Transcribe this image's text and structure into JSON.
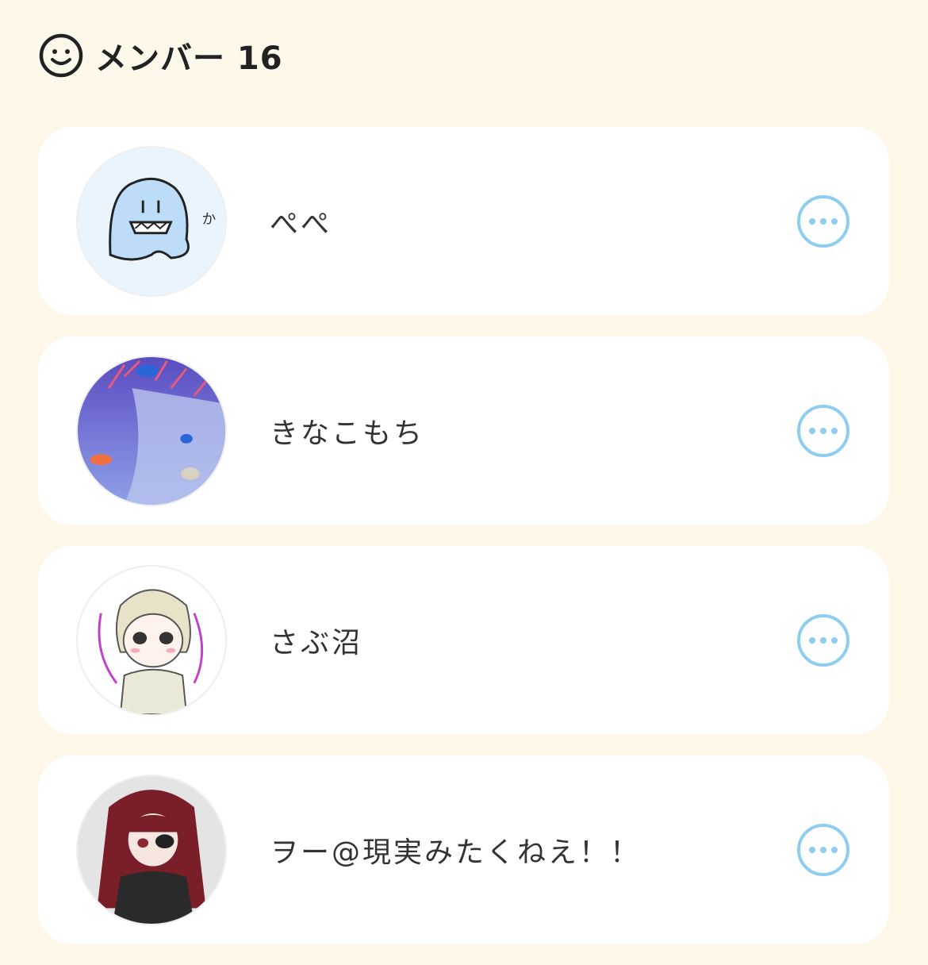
{
  "header": {
    "icon": "smile-icon",
    "title": "メンバー 16"
  },
  "colors": {
    "background": "#fdf8ea",
    "card": "#ffffff",
    "accent": "#8ecdf0"
  },
  "members": [
    {
      "name": "ぺぺ",
      "avatar": "ghost-avatar",
      "more_icon": "more-options-icon"
    },
    {
      "name": "きなこもち",
      "avatar": "aquarium-avatar",
      "more_icon": "more-options-icon"
    },
    {
      "name": "さぶ沼",
      "avatar": "anime-girl-avatar",
      "more_icon": "more-options-icon"
    },
    {
      "name": "ヲー@現実みたくねえ！！",
      "avatar": "red-hair-avatar",
      "more_icon": "more-options-icon"
    }
  ]
}
